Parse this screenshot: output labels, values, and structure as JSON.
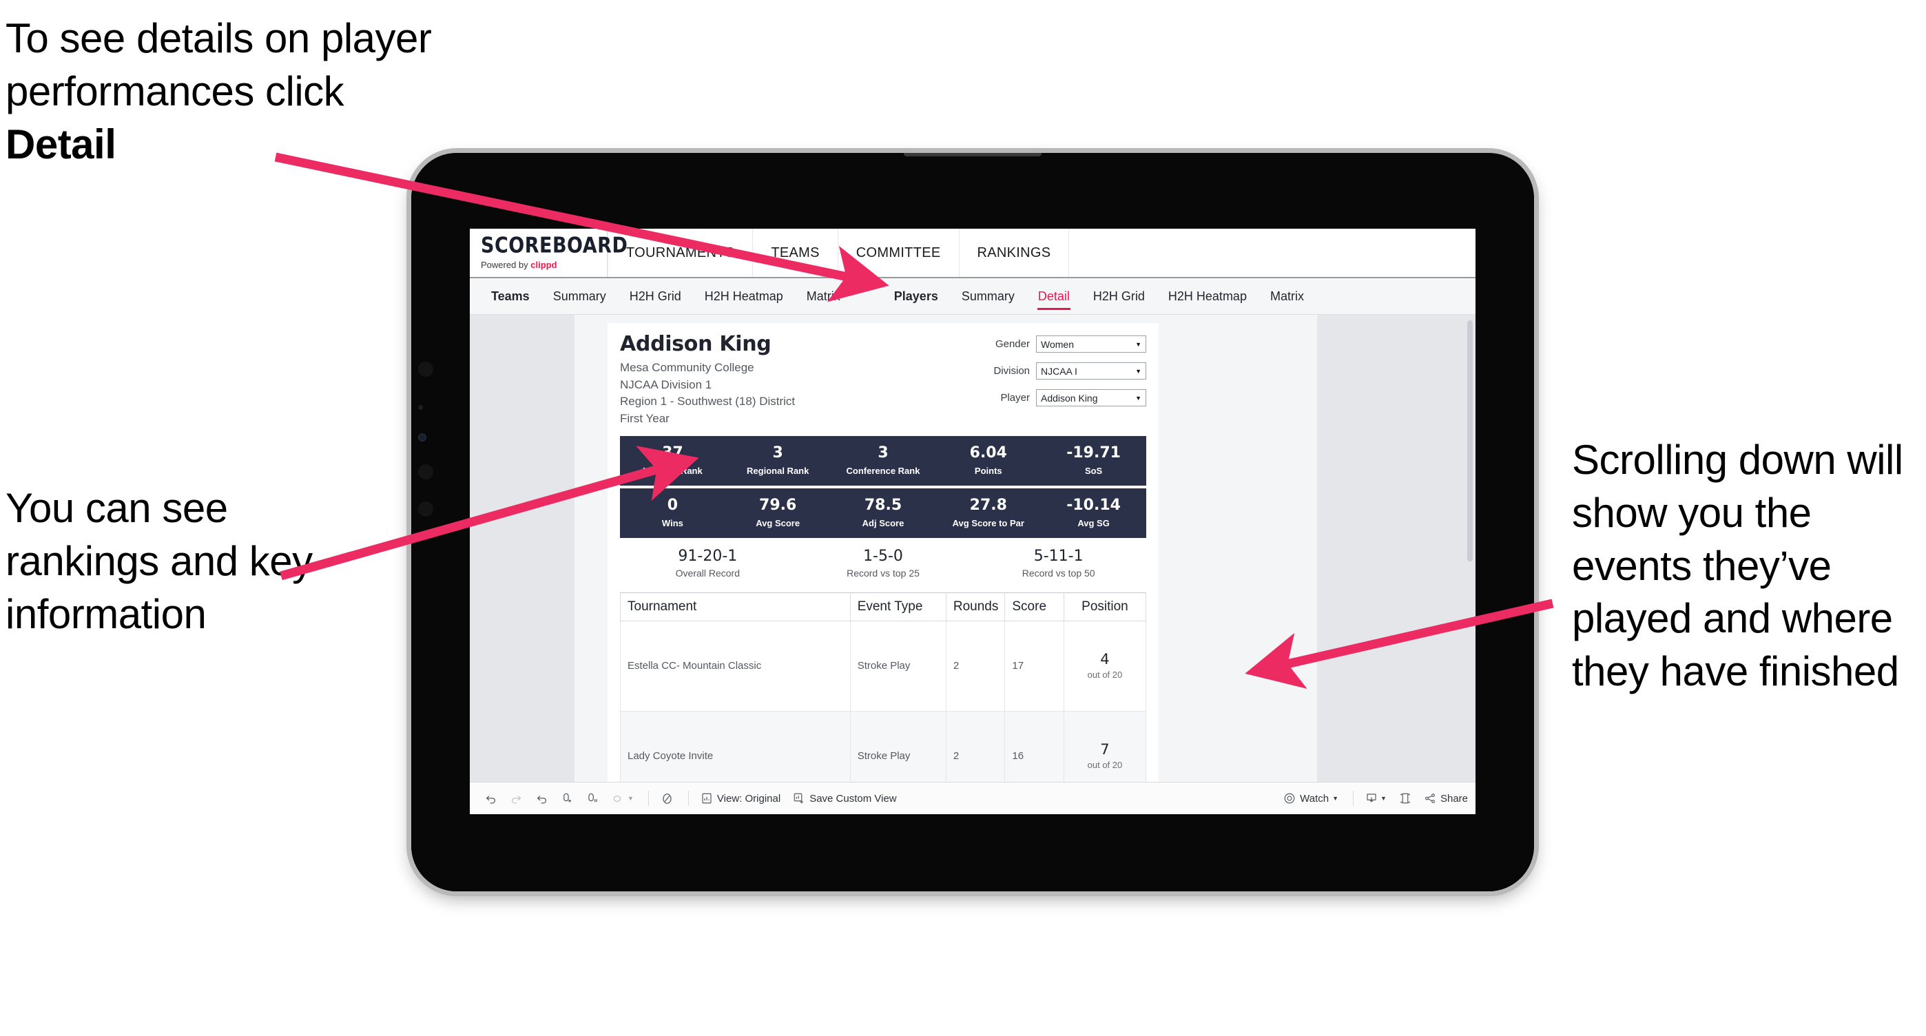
{
  "annotations": {
    "detail": "To see details on player performances click ",
    "detail_bold": "Detail",
    "rankings": "You can see rankings and key information",
    "scrolling": "Scrolling down will show you the events they’ve played and where they have finished"
  },
  "colors": {
    "accent_pink": "#e8164f",
    "arrow_pink": "#ec2b63",
    "navy": "#2b3148",
    "brand_red": "#ed1b4c"
  },
  "app": {
    "brand": {
      "title": "SCOREBOARD",
      "powered_prefix": "Powered by ",
      "powered_name": "clippd"
    },
    "topnav": [
      "TOURNAMENTS",
      "TEAMS",
      "COMMITTEE",
      "RANKINGS"
    ],
    "tabs_teams": [
      {
        "label": "Teams",
        "active": false,
        "head": true
      },
      {
        "label": "Summary",
        "active": false,
        "head": false
      },
      {
        "label": "H2H Grid",
        "active": false,
        "head": false
      },
      {
        "label": "H2H Heatmap",
        "active": false,
        "head": false
      },
      {
        "label": "Matrix",
        "active": false,
        "head": false
      }
    ],
    "tabs_players": [
      {
        "label": "Players",
        "active": false,
        "head": true
      },
      {
        "label": "Summary",
        "active": false,
        "head": false
      },
      {
        "label": "Detail",
        "active": true,
        "head": false
      },
      {
        "label": "H2H Grid",
        "active": false,
        "head": false
      },
      {
        "label": "H2H Heatmap",
        "active": false,
        "head": false
      },
      {
        "label": "Matrix",
        "active": false,
        "head": false
      }
    ]
  },
  "player": {
    "name": "Addison King",
    "college": "Mesa Community College",
    "division": "NJCAA Division 1",
    "region": "Region 1 - Southwest (18) District",
    "year": "First Year"
  },
  "selectors": [
    {
      "label": "Gender",
      "value": "Women"
    },
    {
      "label": "Division",
      "value": "NJCAA I"
    },
    {
      "label": "Player",
      "value": "Addison King"
    }
  ],
  "stats_row1": [
    {
      "value": "37",
      "label": "National Rank"
    },
    {
      "value": "3",
      "label": "Regional Rank"
    },
    {
      "value": "3",
      "label": "Conference Rank"
    },
    {
      "value": "6.04",
      "label": "Points"
    },
    {
      "value": "-19.71",
      "label": "SoS"
    }
  ],
  "stats_row2": [
    {
      "value": "0",
      "label": "Wins"
    },
    {
      "value": "79.6",
      "label": "Avg Score"
    },
    {
      "value": "78.5",
      "label": "Adj Score"
    },
    {
      "value": "27.8",
      "label": "Avg Score to Par"
    },
    {
      "value": "-10.14",
      "label": "Avg SG"
    }
  ],
  "records": [
    {
      "value": "91-20-1",
      "label": "Overall Record"
    },
    {
      "value": "1-5-0",
      "label": "Record vs top 25"
    },
    {
      "value": "5-11-1",
      "label": "Record vs top 50"
    }
  ],
  "table": {
    "headers": [
      "Tournament",
      "Event Type",
      "Rounds",
      "Score",
      "Position"
    ],
    "rows": [
      {
        "tournament": "Estella CC- Mountain Classic",
        "event_type": "Stroke Play",
        "rounds": "2",
        "score": "17",
        "position": "4",
        "position_sub": "out of 20"
      },
      {
        "tournament": "Lady Coyote Invite",
        "event_type": "Stroke Play",
        "rounds": "2",
        "score": "16",
        "position": "7",
        "position_sub": "out of 20"
      }
    ]
  },
  "toolbar": {
    "undo": "undo-icon",
    "redo": "redo-icon",
    "revert": "revert-icon",
    "refresh": "refresh-data-icon",
    "pause": "pause-auto-update-icon",
    "share_custom": "share-custom-icon",
    "alert": "alert-icon",
    "view_label": "View: Original",
    "save_label": "Save Custom View",
    "watch_label": "Watch",
    "download": "download-icon",
    "fullscreen": "fullscreen-icon",
    "share_label": "Share"
  }
}
